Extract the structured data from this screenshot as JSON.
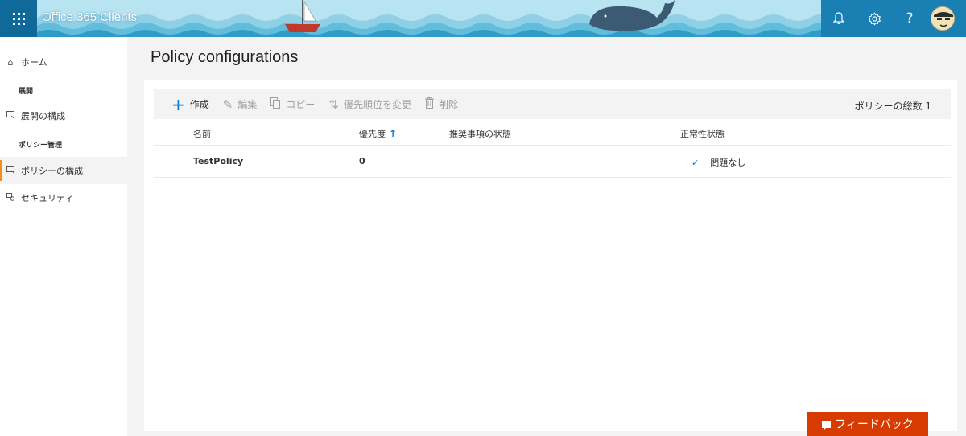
{
  "header": {
    "app_title": "Office 365 Clients",
    "icons": [
      "waffle-icon",
      "bell-icon",
      "gear-icon",
      "help-icon",
      "avatar"
    ],
    "help_glyph": "?",
    "theme_colors": {
      "banner": "#aee0ef",
      "waffle": "#0f6a9a",
      "right_bar": "#1a7fb2"
    }
  },
  "sidebar": {
    "home": "ホーム",
    "section_deploy": "展開",
    "deploy_config": "展開の構成",
    "section_policy": "ポリシー管理",
    "policy_config": "ポリシーの構成",
    "security": "セキュリティ"
  },
  "main": {
    "title": "Policy configurations",
    "commands": {
      "create": "作成",
      "edit": "編集",
      "copy": "コピー",
      "change_priority": "優先順位を変更",
      "delete": "削除"
    },
    "total_label": "ポリシーの総数 1",
    "columns": {
      "name": "名前",
      "priority": "優先度",
      "recommendation_status": "推奨事項の状態",
      "health_status": "正常性状態"
    },
    "rows": [
      {
        "name": "TestPolicy",
        "priority": "0",
        "recommendation_status": "",
        "health_status": "問題なし"
      }
    ]
  },
  "feedback": {
    "label": "フィードバック",
    "color": "#d83b01"
  },
  "accent_color": "#0078d4",
  "active_nav_color": "#f28c1b"
}
